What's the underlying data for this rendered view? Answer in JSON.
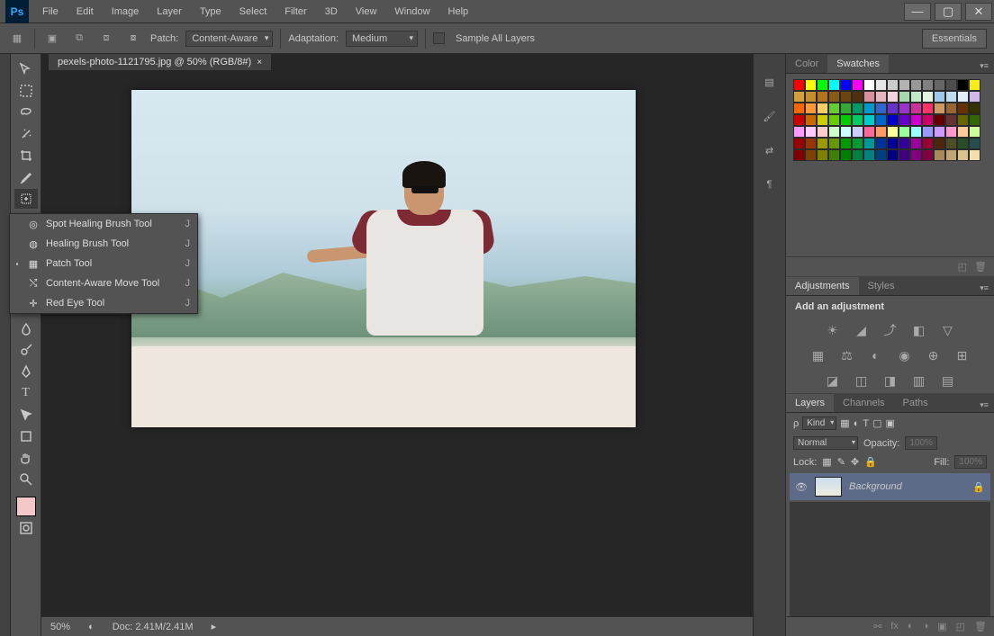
{
  "menu": [
    "File",
    "Edit",
    "Image",
    "Layer",
    "Type",
    "Select",
    "Filter",
    "3D",
    "View",
    "Window",
    "Help"
  ],
  "optbar": {
    "patch_label": "Patch:",
    "patch_value": "Content-Aware",
    "adapt_label": "Adaptation:",
    "adapt_value": "Medium",
    "sample_label": "Sample All Layers",
    "essentials": "Essentials"
  },
  "doc": {
    "tab": "pexels-photo-1121795.jpg @ 50% (RGB/8#)"
  },
  "status": {
    "zoom": "50%",
    "doc": "Doc: 2.41M/2.41M"
  },
  "flyout": [
    {
      "label": "Spot Healing Brush Tool",
      "key": "J",
      "sel": false
    },
    {
      "label": "Healing Brush Tool",
      "key": "J",
      "sel": false
    },
    {
      "label": "Patch Tool",
      "key": "J",
      "sel": true
    },
    {
      "label": "Content-Aware Move Tool",
      "key": "J",
      "sel": false
    },
    {
      "label": "Red Eye Tool",
      "key": "J",
      "sel": false
    }
  ],
  "panels": {
    "color_tabs": [
      "Color",
      "Swatches"
    ],
    "adjustments_tabs": [
      "Adjustments",
      "Styles"
    ],
    "adjustments_title": "Add an adjustment",
    "layers_tabs": [
      "Layers",
      "Channels",
      "Paths"
    ],
    "layer_filter": "Kind",
    "blend_mode": "Normal",
    "opacity_label": "Opacity:",
    "opacity_value": "100%",
    "lock_label": "Lock:",
    "fill_label": "Fill:",
    "fill_value": "100%",
    "layer_name": "Background"
  },
  "swatch_colors": [
    "#ff0000",
    "#ffff00",
    "#00ff00",
    "#00ffff",
    "#0000ff",
    "#ff00ff",
    "#ffffff",
    "#e6e6e6",
    "#cccccc",
    "#b3b3b3",
    "#999999",
    "#808080",
    "#666666",
    "#4d4d4d",
    "#000000",
    "#f7ec13",
    "#d3a03c",
    "#c58f2a",
    "#b07420",
    "#8a5a18",
    "#6b4412",
    "#4f320d",
    "#d88fa0",
    "#e5b5c0",
    "#f0d5dd",
    "#a8d8b0",
    "#c5e8ca",
    "#e0f5e3",
    "#a0c8e8",
    "#c0ddf0",
    "#e0eff8",
    "#d0b8e8",
    "#ff6600",
    "#ff9933",
    "#ffcc66",
    "#66cc33",
    "#33aa33",
    "#009966",
    "#0099cc",
    "#3366cc",
    "#6633cc",
    "#9933cc",
    "#cc3399",
    "#ff3366",
    "#cc9966",
    "#996633",
    "#663300",
    "#333300",
    "#cc0000",
    "#cc6600",
    "#cccc00",
    "#66cc00",
    "#00cc00",
    "#00cc66",
    "#00cccc",
    "#0066cc",
    "#0000cc",
    "#6600cc",
    "#cc00cc",
    "#cc0066",
    "#660000",
    "#663333",
    "#666600",
    "#336600",
    "#ff99ff",
    "#ffccff",
    "#ffcccc",
    "#ccffcc",
    "#ccffff",
    "#ccccff",
    "#ff6699",
    "#ff9966",
    "#ffff99",
    "#99ff99",
    "#99ffff",
    "#9999ff",
    "#cc99ff",
    "#ff99cc",
    "#ffcc99",
    "#ccff99",
    "#990000",
    "#993300",
    "#999900",
    "#669900",
    "#009900",
    "#009933",
    "#009999",
    "#003399",
    "#000099",
    "#330099",
    "#990099",
    "#990033",
    "#4d260d",
    "#4d4d26",
    "#264d26",
    "#264d4d",
    "#800000",
    "#804000",
    "#808000",
    "#408000",
    "#008000",
    "#008040",
    "#008080",
    "#004080",
    "#000080",
    "#400080",
    "#800080",
    "#800040",
    "#a68a5c",
    "#bfa674",
    "#d9c28f",
    "#f2dfaa"
  ]
}
